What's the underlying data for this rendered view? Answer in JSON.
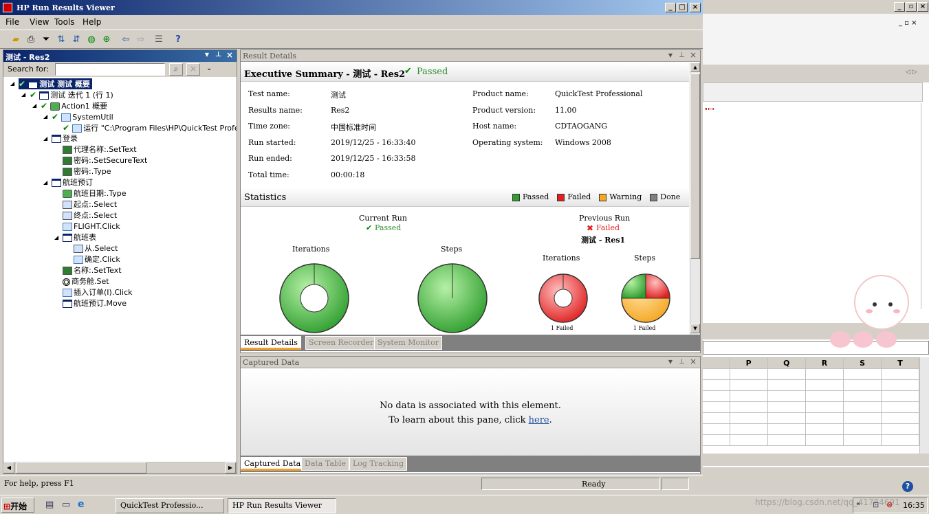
{
  "window": {
    "title": "HP Run Results Viewer"
  },
  "menu": [
    "File",
    "View",
    "Tools",
    "Help"
  ],
  "left_pane": {
    "title": "测试 - Res2",
    "search_label": "Search for:",
    "search_value": "",
    "tree": [
      {
        "label": "测试 测试 概要",
        "status": "passed",
        "icon": "test-icon"
      },
      {
        "label": "测试 迭代 1 (行 1)",
        "status": "passed",
        "icon": "iteration-icon"
      },
      {
        "label": "Action1 概要",
        "status": "passed",
        "icon": "action-icon"
      },
      {
        "label": "SystemUtil",
        "status": "passed",
        "icon": "systemutil-icon"
      },
      {
        "label": "运行 \"C:\\Program Files\\HP\\QuickTest Profess",
        "status": "passed",
        "icon": "run-icon"
      },
      {
        "label": "登录",
        "icon": "window-icon"
      },
      {
        "label": "代理名称:.SetText",
        "icon": "edit-icon"
      },
      {
        "label": "密码:.SetSecureText",
        "icon": "edit-icon"
      },
      {
        "label": "密码:.Type",
        "icon": "edit-icon"
      },
      {
        "label": "航班预订",
        "icon": "window-icon"
      },
      {
        "label": "航班日期:.Type",
        "icon": "cube-icon"
      },
      {
        "label": "起点:.Select",
        "icon": "combobox-icon"
      },
      {
        "label": "终点:.Select",
        "icon": "combobox-icon"
      },
      {
        "label": "FLIGHT.Click",
        "icon": "button-icon"
      },
      {
        "label": "航班表",
        "icon": "dialog-icon"
      },
      {
        "label": "从.Select",
        "icon": "list-icon"
      },
      {
        "label": "确定.Click",
        "icon": "button-icon"
      },
      {
        "label": "名称:.SetText",
        "icon": "edit-icon"
      },
      {
        "label": "商务舱.Set",
        "icon": "radio-icon"
      },
      {
        "label": "插入订单(I).Click",
        "icon": "button-icon"
      },
      {
        "label": "航班预订.Move",
        "icon": "window-icon"
      }
    ]
  },
  "result_details": {
    "pane_title": "Result Details",
    "header": "Executive Summary - 测试 - Res2",
    "header_status": "Passed",
    "fields_left": [
      {
        "k": "Test name:",
        "v": "测试"
      },
      {
        "k": "Results name:",
        "v": "Res2"
      },
      {
        "k": "Time zone:",
        "v": "中国标准时间"
      },
      {
        "k": "Run started:",
        "v": "2019/12/25 - 16:33:40"
      },
      {
        "k": "Run ended:",
        "v": "2019/12/25 - 16:33:58"
      },
      {
        "k": "Total time:",
        "v": "00:00:18"
      }
    ],
    "fields_right": [
      {
        "k": "Product name:",
        "v": "QuickTest Professional"
      },
      {
        "k": "Product version:",
        "v": "11.00"
      },
      {
        "k": "Host name:",
        "v": "CDTAOGANG"
      },
      {
        "k": "Operating system:",
        "v": "Windows 2008"
      }
    ],
    "statistics_title": "Statistics",
    "legend": [
      {
        "label": "Passed",
        "color": "#2e9e2e"
      },
      {
        "label": "Failed",
        "color": "#e02020"
      },
      {
        "label": "Warning",
        "color": "#f5a623"
      },
      {
        "label": "Done",
        "color": "#808080"
      }
    ],
    "current_run": {
      "title": "Current Run",
      "status": "Passed",
      "iterations_label": "Iterations",
      "steps_label": "Steps"
    },
    "previous_run": {
      "title": "Previous Run",
      "status": "Failed",
      "name": "测试 - Res1",
      "iterations_label": "Iterations",
      "steps_label": "Steps",
      "iter_note": "1 Failed",
      "steps_note": "1 Failed"
    },
    "tabs": [
      "Result Details",
      "Screen Recorder",
      "System Monitor"
    ]
  },
  "captured_data": {
    "pane_title": "Captured Data",
    "msg1": "No data is associated with this element.",
    "msg2": "To learn about this pane, click ",
    "link": "here",
    "msg2_end": ".",
    "tabs": [
      "Captured Data",
      "Data Table",
      "Log Tracking"
    ]
  },
  "status": {
    "help": "For help, press F1",
    "state": "Ready"
  },
  "taskbar": {
    "start": "开始",
    "tasks": [
      "QuickTest Professio...",
      "HP Run Results Viewer"
    ],
    "clock": "16:35",
    "watermark": "https://blog.csdn.net/qq_41784691"
  },
  "bg_sheet": {
    "columns": [
      "P",
      "Q",
      "R",
      "S",
      "T"
    ],
    "text": "\"\"\""
  }
}
